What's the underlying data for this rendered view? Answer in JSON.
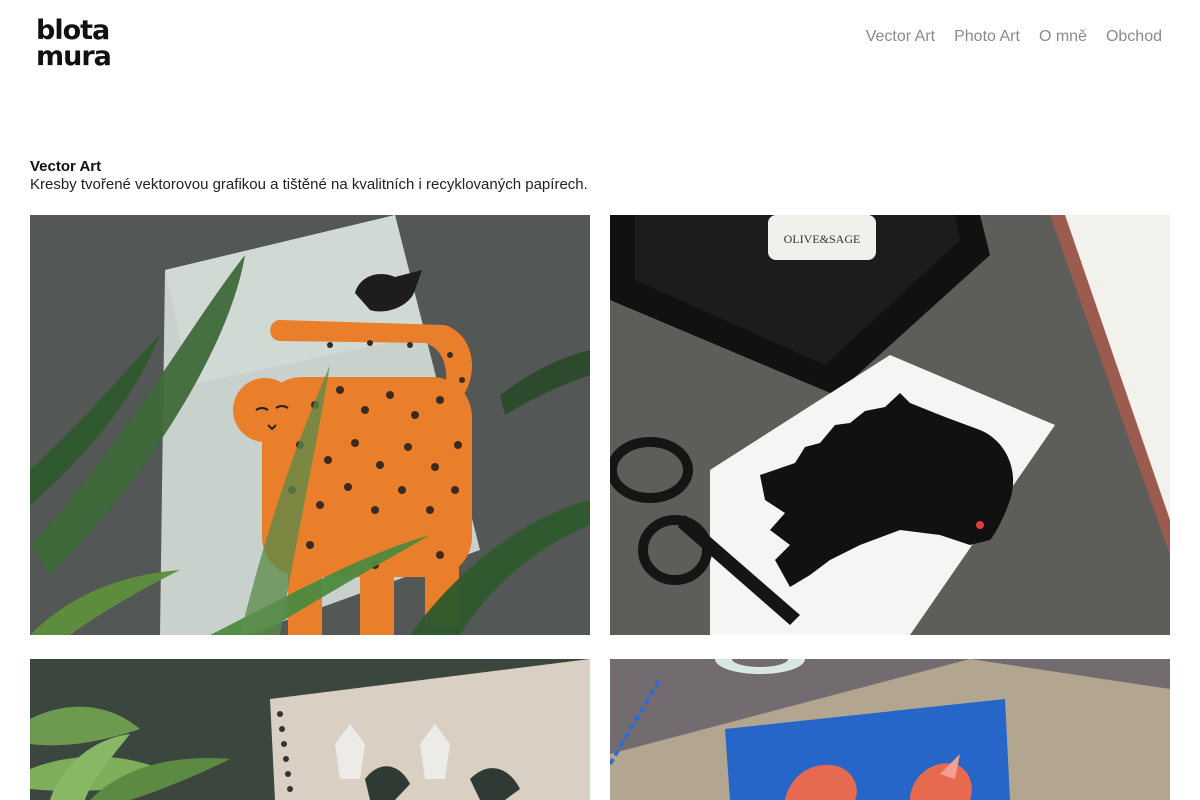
{
  "header": {
    "logo": {
      "line1": "blota",
      "line2": "mura"
    },
    "nav": [
      {
        "label": "Vector Art"
      },
      {
        "label": "Photo Art"
      },
      {
        "label": "O mně"
      },
      {
        "label": "Obchod"
      }
    ]
  },
  "intro": {
    "title": "Vector Art",
    "text": "Kresby tvořené vektorovou grafikou a tištěné na kvalitních i recyklovaných papírech."
  },
  "gallery": {
    "items": [
      {
        "subject": "orange leopard cat with black bird card among plant leaves"
      },
      {
        "subject": "black bird illustration card with scissors, tray and book",
        "label_text": "OLIVE&SAGE"
      },
      {
        "subject": "spiral notebook with flower illustration next to succulent"
      },
      {
        "subject": "blue card with red bird illustration on kraft paper with twine"
      }
    ]
  },
  "colors": {
    "nav_text": "#8a8a8a",
    "heading_text": "#111111",
    "orange": "#e97f2b",
    "leaf_green": "#3f6b3a",
    "card_blue": "#2566c8",
    "bird_red": "#e56a4f"
  }
}
